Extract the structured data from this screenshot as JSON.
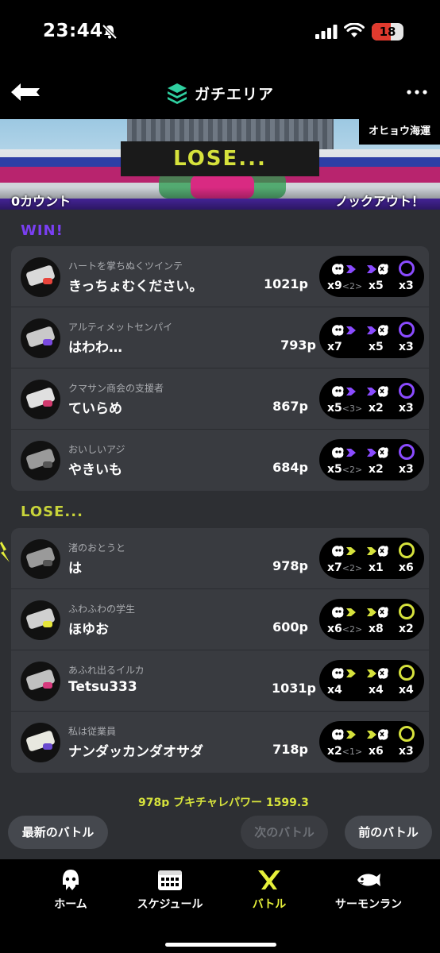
{
  "status_bar": {
    "time": "23:44",
    "icons": [
      "bell-slash-icon",
      "signal-icon",
      "wifi-icon",
      "battery-icon"
    ],
    "battery": "18",
    "battery_level": 0.18
  },
  "nav": {
    "title": "ガチエリア",
    "back_icon": "back-arrow-icon",
    "mode_icon": "splat-zones-icon",
    "more_icon": "more-icon"
  },
  "banner": {
    "result": "LOSE...",
    "stage": "オヒョウ海運",
    "left_count": "0カウント",
    "right_status": "ノックアウト！"
  },
  "teams": {
    "win_label": "WIN!",
    "lose_label": "LOSE...",
    "win_players": [
      {
        "byname": "ハートを掌ちぬくツインテ",
        "name": "きっちょむください。",
        "points": "1021p",
        "kills": "x9",
        "assists": "<2>",
        "specials_used": "x5",
        "special": "x3",
        "weapon_color": "#d9d9d9",
        "accent": "#e8453c",
        "special_color": "#8a4bff"
      },
      {
        "byname": "アルティメットセンパイ",
        "name": "はわわ…",
        "points": "793p",
        "kills": "x7",
        "assists": "",
        "specials_used": "x5",
        "special": "x3",
        "weapon_color": "#c9c9c9",
        "accent": "#7a4ae0",
        "special_color": "#8a4bff"
      },
      {
        "byname": "クマサン商会の支援者",
        "name": "ていらめ",
        "points": "867p",
        "kills": "x5",
        "assists": "<3>",
        "specials_used": "x2",
        "special": "x3",
        "weapon_color": "#e0e0e0",
        "accent": "#d13a6e",
        "special_color": "#8a4bff"
      },
      {
        "byname": "おいしいアジ",
        "name": "やきいも",
        "points": "684p",
        "kills": "x5",
        "assists": "<2>",
        "specials_used": "x2",
        "special": "x3",
        "weapon_color": "#9a9a9a",
        "accent": "#555555",
        "special_color": "#8a4bff"
      }
    ],
    "lose_players": [
      {
        "byname": "渚のおとうと",
        "name": "は",
        "points": "978p",
        "kills": "x7",
        "assists": "<2>",
        "specials_used": "x1",
        "special": "x6",
        "weapon_color": "#9a9a9a",
        "accent": "#555555",
        "special_color": "#d6e23c"
      },
      {
        "byname": "ふわふわの学生",
        "name": "ほゆお",
        "points": "600p",
        "kills": "x6",
        "assists": "<2>",
        "specials_used": "x8",
        "special": "x2",
        "weapon_color": "#d0d0d0",
        "accent": "#e6e63a",
        "special_color": "#d6e23c"
      },
      {
        "byname": "あふれ出るイルカ",
        "name": "Tetsu333",
        "points": "1031p",
        "kills": "x4",
        "assists": "",
        "specials_used": "x4",
        "special": "x4",
        "weapon_color": "#c0c0c0",
        "accent": "#d83a7e",
        "special_color": "#d6e23c"
      },
      {
        "byname": "私は従業員",
        "name": "ナンダッカンダオサダ",
        "points": "718p",
        "kills": "x2",
        "assists": "<1>",
        "specials_used": "x6",
        "special": "x3",
        "weapon_color": "#e8e8e0",
        "accent": "#6a4ad0",
        "special_color": "#d6e23c"
      }
    ],
    "footer": "978p  ブキチャレパワー 1599.3"
  },
  "buttons": {
    "latest": "最新のバトル",
    "next": "次のバトル",
    "prev": "前のバトル"
  },
  "tabs": [
    {
      "label": "ホーム",
      "icon": "squid-icon"
    },
    {
      "label": "スケジュール",
      "icon": "calendar-icon"
    },
    {
      "label": "バトル",
      "icon": "battle-icon"
    },
    {
      "label": "サーモンラン",
      "icon": "salmon-icon"
    }
  ],
  "colors": {
    "win": "#7a3ff2",
    "lose": "#c8d43a",
    "active_tab": "#e6f03a",
    "panel": "#393b40",
    "background": "#2d2f33"
  }
}
